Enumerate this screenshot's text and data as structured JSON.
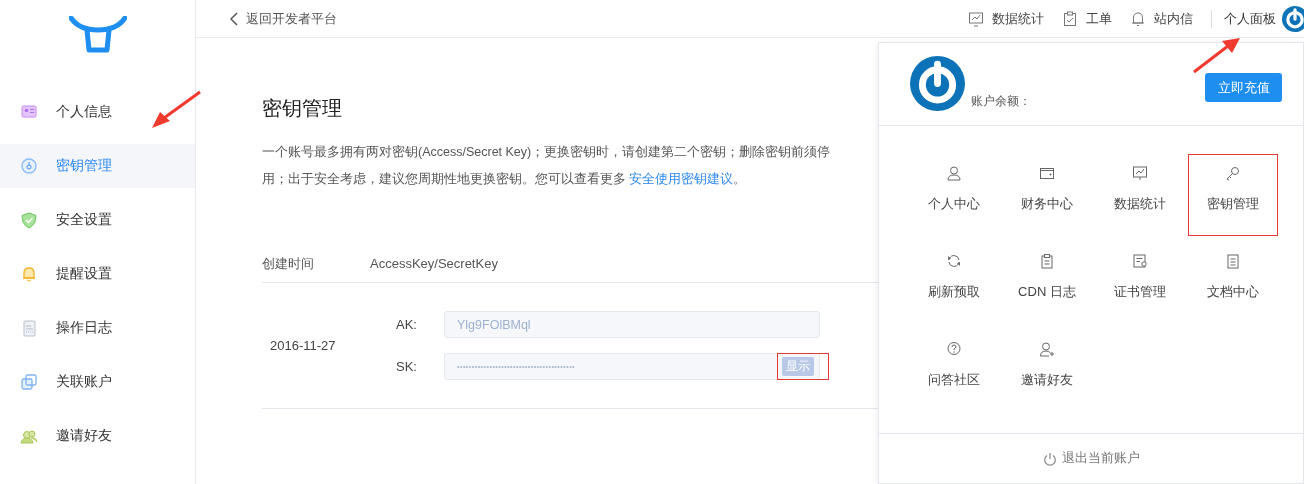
{
  "sidebar": {
    "items": [
      {
        "label": "个人信息",
        "selected": false
      },
      {
        "label": "密钥管理",
        "selected": true
      },
      {
        "label": "安全设置",
        "selected": false
      },
      {
        "label": "提醒设置",
        "selected": false
      },
      {
        "label": "操作日志",
        "selected": false
      },
      {
        "label": "关联账户",
        "selected": false
      },
      {
        "label": "邀请好友",
        "selected": false
      }
    ]
  },
  "topbar": {
    "back": "返回开发者平台",
    "links": [
      "数据统计",
      "工单",
      "站内信"
    ],
    "panel_link": "个人面板"
  },
  "annotations": [
    {
      "kind": "arrow"
    },
    {
      "kind": "arrow"
    }
  ],
  "page": {
    "title": "密钥管理",
    "description": "一个账号最多拥有两对密钥(Access/Secret Key)；更换密钥时，请创建第二个密钥；删除密钥前须停用；出于安全考虑，建议您周期性地更换密钥。您可以查看更多 ",
    "description_link": "安全使用密钥建议",
    "description_end": "。"
  },
  "table": {
    "columns": [
      "创建时间",
      "AccessKey/SecretKey"
    ],
    "rows": [
      {
        "created": "2016-11-27",
        "ak_label": "AK:",
        "ak": "Ylg9FOlBMql",
        "sk_label": "SK:",
        "sk": "••••••••••••••••••••••••••••••••••••••••",
        "show_button": {
          "label": "显示",
          "highlighted": true
        }
      }
    ]
  },
  "panel": {
    "balance_label": "账户余额：",
    "recharge_button": "立即充值",
    "items": [
      {
        "label": "个人中心",
        "highlighted": false
      },
      {
        "label": "财务中心",
        "highlighted": false
      },
      {
        "label": "数据统计",
        "highlighted": false
      },
      {
        "label": "密钥管理",
        "highlighted": true
      },
      {
        "label": "刷新预取",
        "highlighted": false
      },
      {
        "label": "CDN 日志",
        "highlighted": false
      },
      {
        "label": "证书管理",
        "highlighted": false
      },
      {
        "label": "文档中心",
        "highlighted": false
      },
      {
        "label": "问答社区",
        "highlighted": false
      },
      {
        "label": "邀请好友",
        "highlighted": false
      }
    ],
    "logout": "退出当前账户"
  }
}
